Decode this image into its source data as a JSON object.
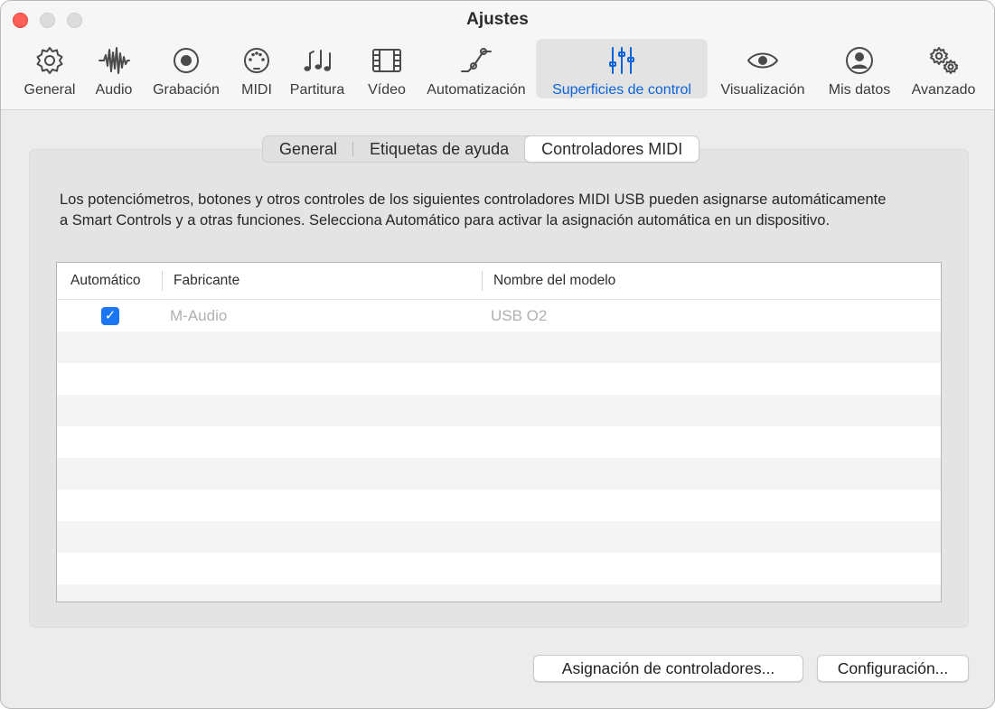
{
  "window": {
    "title": "Ajustes"
  },
  "toolbar": {
    "items": [
      {
        "label": "General",
        "icon": "gear-icon"
      },
      {
        "label": "Audio",
        "icon": "waveform-icon"
      },
      {
        "label": "Grabación",
        "icon": "record-icon"
      },
      {
        "label": "MIDI",
        "icon": "midi-port-icon"
      },
      {
        "label": "Partitura",
        "icon": "music-notes-icon"
      },
      {
        "label": "Vídeo",
        "icon": "film-icon"
      },
      {
        "label": "Automatización",
        "icon": "automation-curve-icon"
      },
      {
        "label": "Superficies de control",
        "icon": "sliders-icon",
        "selected": true
      },
      {
        "label": "Visualización",
        "icon": "eye-icon"
      },
      {
        "label": "Mis datos",
        "icon": "person-icon"
      },
      {
        "label": "Avanzado",
        "icon": "gears-icon"
      }
    ],
    "selected_color": "#0a63d8"
  },
  "tabs": [
    {
      "label": "General"
    },
    {
      "label": "Etiquetas de ayuda"
    },
    {
      "label": "Controladores MIDI",
      "active": true
    }
  ],
  "description": "Los potenciómetros, botones y otros controles de los siguientes controladores MIDI USB pueden asignarse automáticamente a Smart Controls y a otras funciones. Selecciona Automático para activar la asignación automática en un dispositivo.",
  "table": {
    "columns": [
      "Automático",
      "Fabricante",
      "Nombre del modelo"
    ],
    "rows": [
      {
        "automatic": true,
        "manufacturer": "M-Audio",
        "model": "USB O2"
      }
    ]
  },
  "buttons": {
    "assignments": "Asignación de controladores...",
    "setup": "Configuración..."
  }
}
